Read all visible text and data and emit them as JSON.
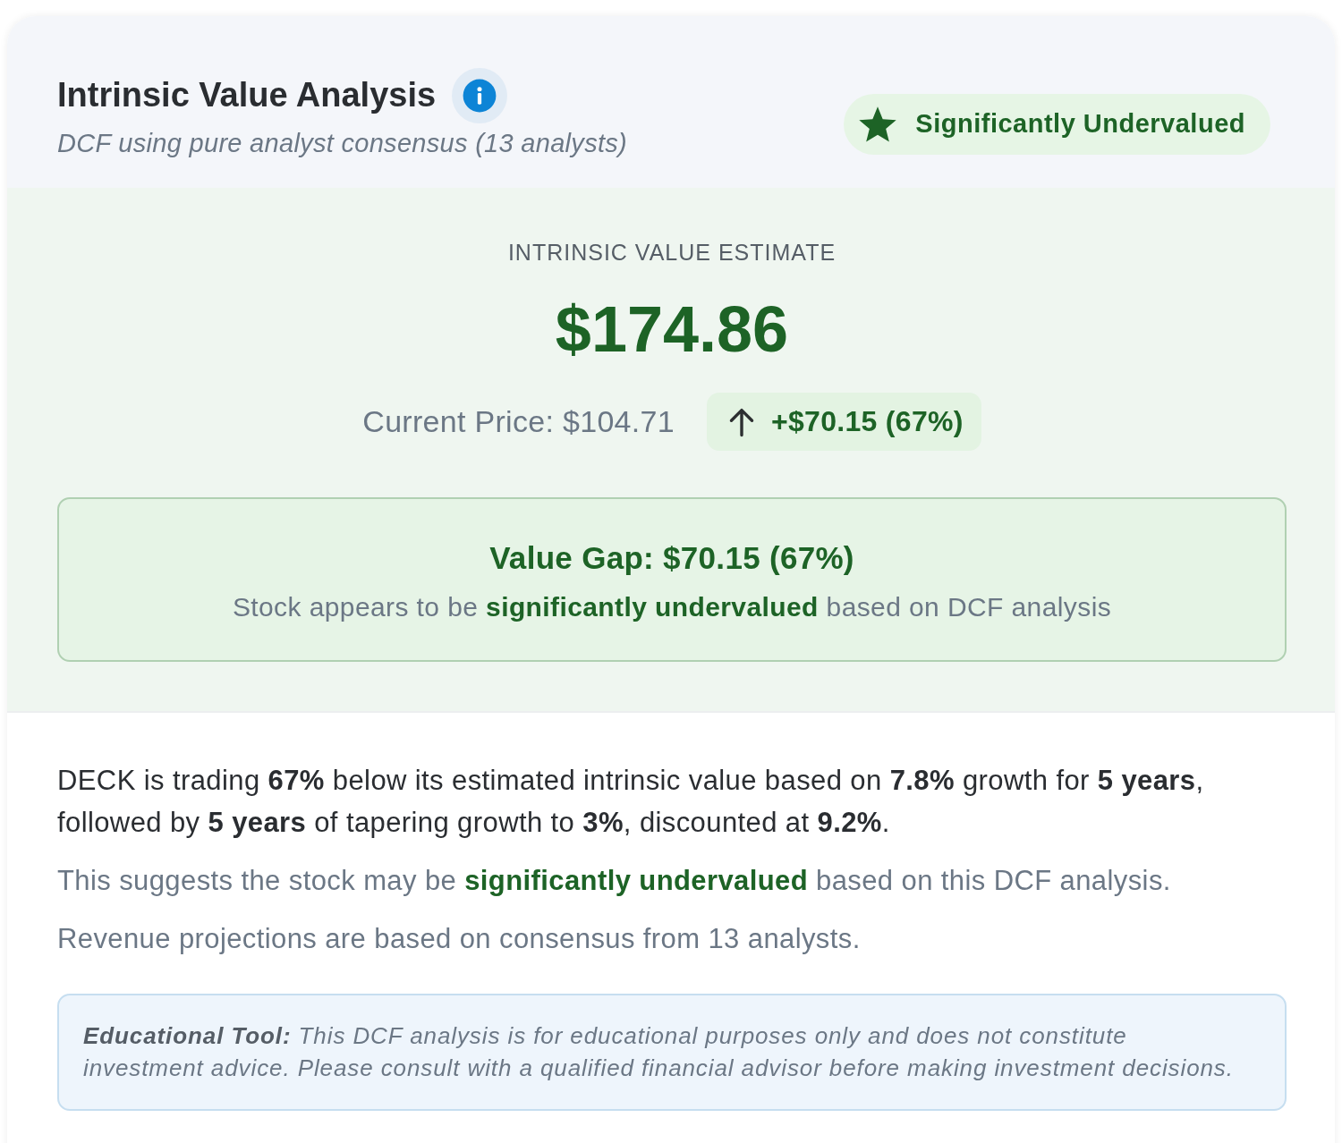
{
  "header": {
    "title": "Intrinsic Value Analysis",
    "subtitle": "DCF using pure analyst consensus (13 analysts)",
    "badge": "Significantly Undervalued"
  },
  "estimate": {
    "label": "INTRINSIC VALUE ESTIMATE",
    "value": "$174.86",
    "current_price": "Current Price: $104.71",
    "change": "+$70.15 (67%)"
  },
  "value_gap": {
    "title": "Value Gap: $70.15 (67%)",
    "text": "Stock appears to be **significantly undervalued** based on DCF analysis"
  },
  "summary": [
    {
      "kind": "lead",
      "text": "DECK is trading **67%** below its estimated intrinsic value based on **7.8%** growth for **5 years**, followed by **5 years** of tapering growth to **3%**, discounted at **9.2%**."
    },
    {
      "kind": "note",
      "text": "This suggests the stock may be **significantly undervalued** based on this DCF analysis."
    },
    {
      "kind": "note",
      "text": "Revenue projections are based on consensus from 13 analysts."
    }
  ],
  "disclaimer": "**Educational Tool:** This DCF analysis is for educational purposes only and does not constitute investment advice. Please consult with a qualified financial advisor before making investment decisions."
}
